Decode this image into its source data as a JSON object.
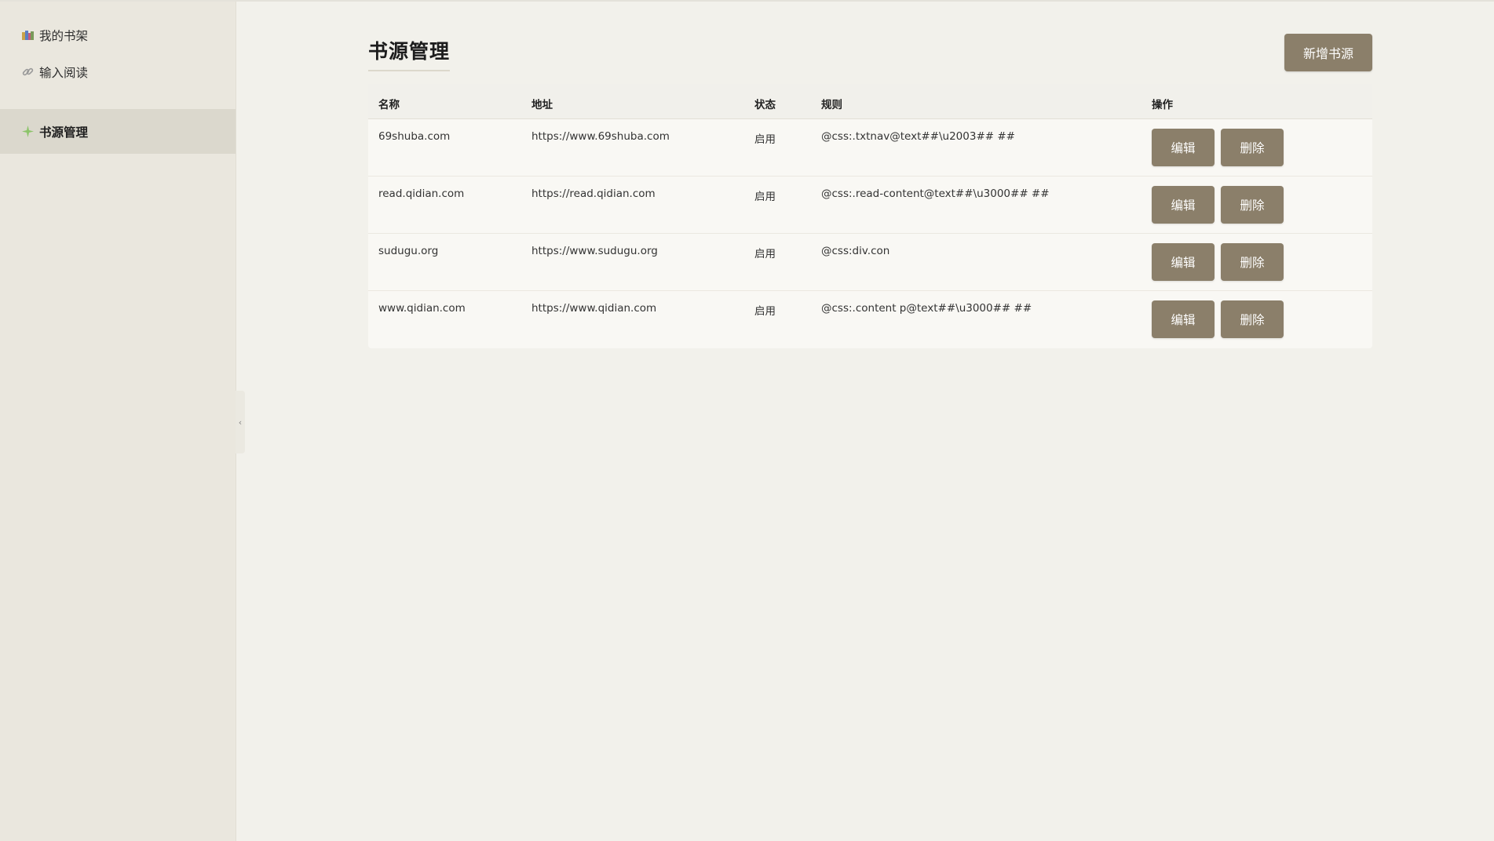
{
  "sidebar": {
    "items": [
      {
        "label": "我的书架",
        "icon": "books-icon",
        "active": false
      },
      {
        "label": "输入阅读",
        "icon": "link-icon",
        "active": false
      },
      {
        "label": "书源管理",
        "icon": "sparkle-icon",
        "active": true
      }
    ],
    "collapse_glyph": "‹"
  },
  "main": {
    "title": "书源管理",
    "add_button_label": "新增书源",
    "table": {
      "columns": [
        "名称",
        "地址",
        "状态",
        "规则",
        "操作"
      ],
      "rows": [
        {
          "name": "69shuba.com",
          "url": "https://www.69shuba.com",
          "status": "启用",
          "rule": "@css:.txtnav@text##\\u2003## ##",
          "edit": "编辑",
          "delete": "删除"
        },
        {
          "name": "read.qidian.com",
          "url": "https://read.qidian.com",
          "status": "启用",
          "rule": "@css:.read-content@text##\\u3000## ##",
          "edit": "编辑",
          "delete": "删除"
        },
        {
          "name": "sudugu.org",
          "url": "https://www.sudugu.org",
          "status": "启用",
          "rule": "@css:div.con",
          "edit": "编辑",
          "delete": "删除"
        },
        {
          "name": "www.qidian.com",
          "url": "https://www.qidian.com",
          "status": "启用",
          "rule": "@css:.content p@text##\\u3000## ##",
          "edit": "编辑",
          "delete": "删除"
        }
      ]
    }
  },
  "colors": {
    "accent": "#8b7f6a",
    "sidebar_bg": "#eae7de",
    "sidebar_active": "#dbd8cd",
    "page_bg": "#f2f1eb"
  }
}
